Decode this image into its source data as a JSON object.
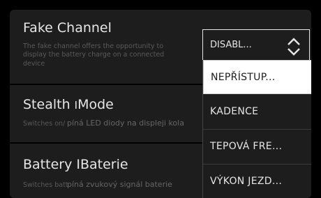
{
  "fake_channel": {
    "title": "Fake Channel",
    "description_line1": "The fake channel offers the opportunity to",
    "description_line2": "display the battery charge on a connected",
    "description_line3": "device",
    "select_value": "DISABL..."
  },
  "stealth_mode": {
    "title_part1": "Stealth ",
    "title_part2": "Mode",
    "description_prefix": "Switches on/",
    "description_overlay": "píná LED diody na displeji kola"
  },
  "battery": {
    "title_part1": "Battery ",
    "title_part2": "IBaterie",
    "description_prefix": "Switches batt",
    "description_overlay": "píná zvukový signál baterie"
  },
  "dropdown": {
    "options": [
      "NEPŘÍSTUP...",
      "KADENCE",
      "TEPOVÁ FRE...",
      "VÝKON JEZD..."
    ],
    "highlighted_index": 0
  },
  "colors": {
    "background": "#000000",
    "panel": "#1d1d1d",
    "text": "#e6e6e6",
    "muted": "#5a5a5a",
    "highlight": "#ffffff"
  }
}
